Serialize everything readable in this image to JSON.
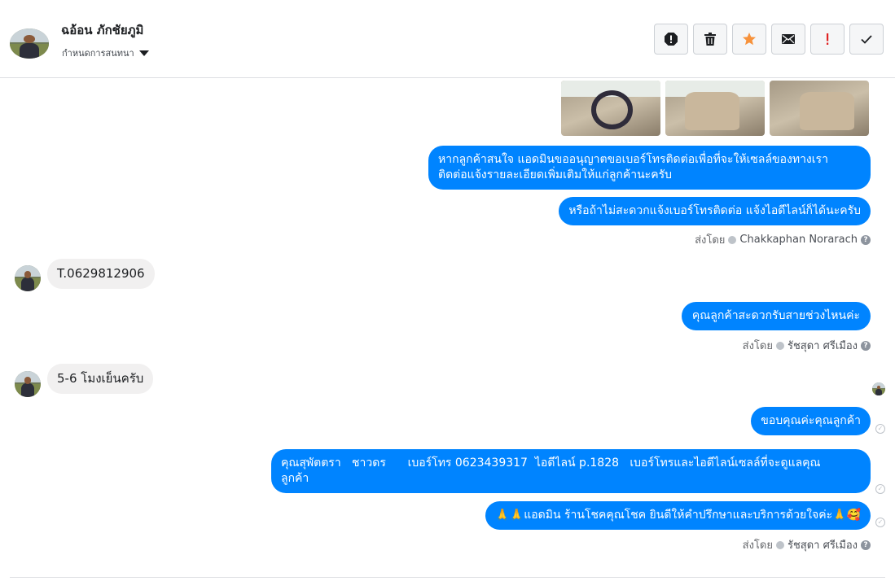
{
  "header": {
    "contact_name": "ฉอ้อน ภักชัยภูมิ",
    "subtitle": "กำหนดการสนทนา"
  },
  "toolbar": {
    "buttons": [
      {
        "icon": "spam-alert-icon",
        "color": "#1c1e21"
      },
      {
        "icon": "trash-icon",
        "color": "#1c1e21"
      },
      {
        "icon": "star-icon",
        "color": "#f7923b"
      },
      {
        "icon": "envelope-icon",
        "color": "#1c1e21"
      },
      {
        "icon": "exclamation-icon",
        "color": "#e02424"
      },
      {
        "icon": "checkmark-icon",
        "color": "#1c1e21"
      }
    ]
  },
  "thread": {
    "messages": [
      {
        "text": "หากลูกค้าสนใจ แอดมินขออนุญาตขอเบอร์โทรติดต่อเพื่อที่จะให้เซลล์ของทางเรา\nติดต่อแจ้งรายละเอียดเพิ่มเติมให้แก่ลูกค้านะครับ"
      },
      {
        "text": "หรือถ้าไม่สะดวกแจ้งเบอร์โทรติดต่อ แจ้งไอดีไลน์ก็ได้นะครับ"
      },
      {
        "sent_by_label": "ส่งโดย",
        "sender": "Chakkaphan Norarach"
      },
      {
        "text": "T.0629812906"
      },
      {
        "text": "คุณลูกค้าสะดวกรับสายช่วงไหนค่ะ"
      },
      {
        "sent_by_label": "ส่งโดย",
        "sender": "รัชสุดา ศรีเมือง"
      },
      {
        "text": "5-6 โมงเย็นครับ"
      },
      {
        "text": "ขอบคุณค่ะคุณลูกค้า"
      },
      {
        "text": "คุณสุพัตตรา   ชาวดร      เบอร์โทร 0623439317  ไอดีไลน์ p.1828   เบอร์โทรและไอดีไลน์เซลล์ที่จะดูแลคุณ\nลูกค้า"
      },
      {
        "text": "🙏🙏แอดมิน ร้านโชคคุณโชค ยินดีให้คำปรึกษาและบริการด้วยใจค่ะ🙏🥰"
      },
      {
        "sent_by_label": "ส่งโดย",
        "sender": "รัชสุดา ศรีเมือง"
      }
    ]
  },
  "colors": {
    "outgoing_bubble": "#0084ff",
    "incoming_bubble": "#f1f0f0",
    "star": "#f7923b",
    "alert": "#e02424"
  }
}
